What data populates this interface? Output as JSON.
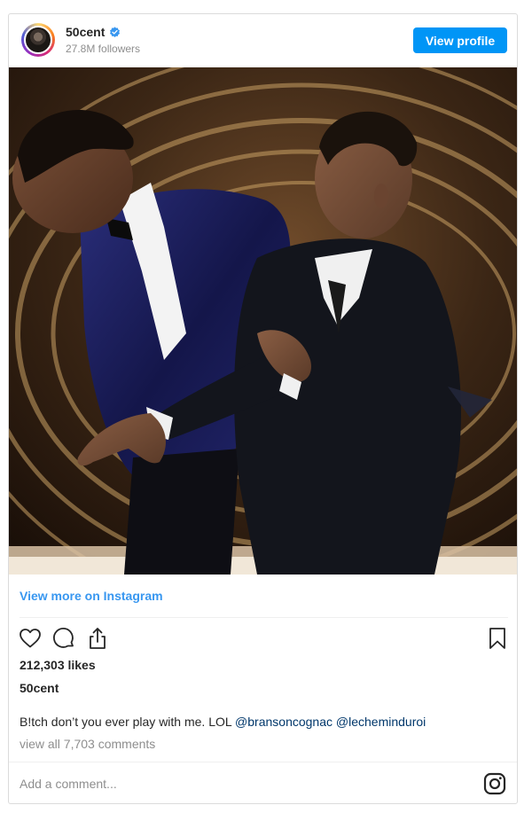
{
  "header": {
    "username": "50cent",
    "verified": true,
    "followers": "27.8M followers",
    "view_profile_label": "View profile"
  },
  "post": {
    "image_alt": "Photo",
    "view_more_label": "View more on Instagram",
    "likes": "212,303 likes",
    "author": "50cent",
    "caption_text": "B!tch don’t you ever play with me. LOL ",
    "mentions": [
      "@bransoncognac",
      "@lecheminduroi"
    ],
    "view_all_comments": "view all 7,703 comments"
  },
  "actions": {
    "icons": [
      "heart-icon",
      "comment-icon",
      "share-icon",
      "bookmark-icon"
    ]
  },
  "comment": {
    "placeholder": "Add a comment..."
  },
  "colors": {
    "accent": "#0095f6",
    "link": "#3897f0",
    "muted": "#8e8e8e",
    "text": "#262626",
    "verified": "#3897f0"
  }
}
